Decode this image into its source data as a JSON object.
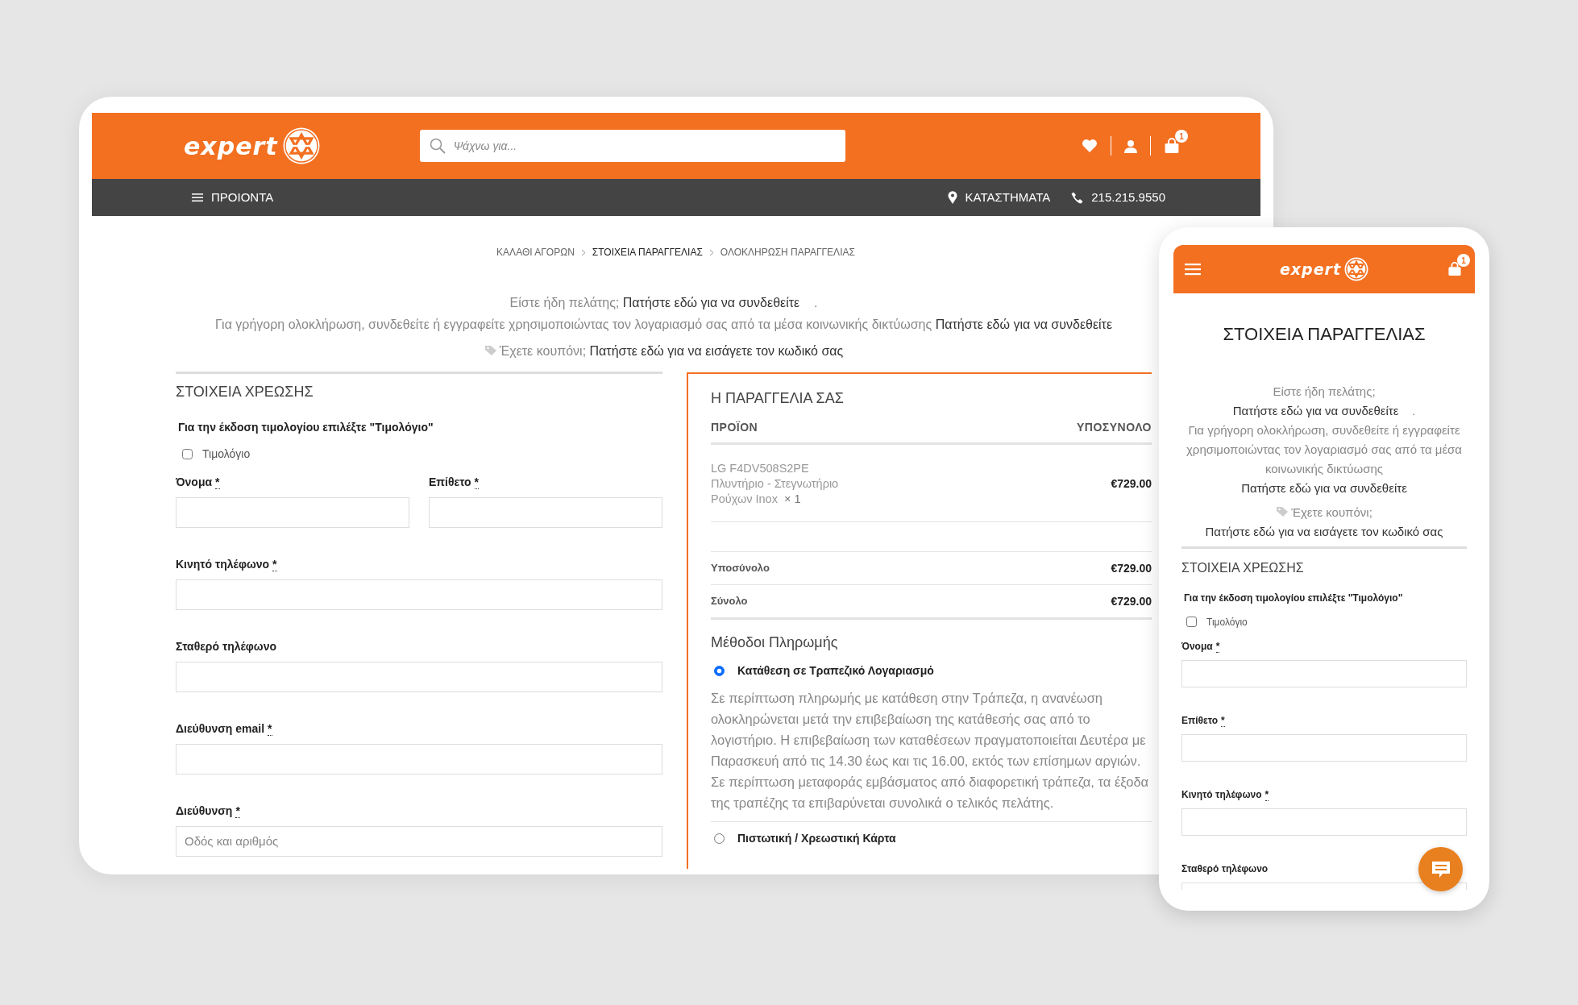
{
  "desktop": {
    "header": {
      "logo_text": "expert",
      "search_placeholder": "Ψάχνω για...",
      "cart_count": "1"
    },
    "nav": {
      "menu": "ΠΡΟΙΟΝΤΑ",
      "stores": "ΚΑΤΑΣΤΗΜΑΤΑ",
      "phone": "215.215.9550"
    },
    "breadcrumb": [
      {
        "label": "ΚΑΛΑΘΙ ΑΓΟΡΩΝ",
        "selected": false
      },
      {
        "label": "ΣΤΟΙΧΕΙΑ ΠΑΡΑΓΓΕΛΙΑΣ",
        "selected": true
      },
      {
        "label": "ΟΛΟΚΛΗΡΩΣΗ ΠΑΡΑΓΓΕΛΙΑΣ",
        "selected": false
      }
    ],
    "notices": [
      {
        "kind": "login",
        "text": "Είστε ήδη πελάτης;",
        "link": "Πατήστε εδώ για να συνδεθείτε",
        "suffix": "."
      },
      {
        "kind": "login",
        "text": "Για γρήγορη ολοκλήρωση, συνδεθείτε ή εγγραφείτε χρησιμοποιώντας τον λογαριασμό σας από τα μέσα κοινωνικής δικτύωσης",
        "link": "Πατήστε εδώ για να συνδεθείτε"
      },
      {
        "kind": "coupon",
        "text": "Έχετε κουπόνι;",
        "link": "Πατήστε εδώ για να εισάγετε τον κωδικό σας"
      }
    ],
    "billing": {
      "title": "ΣΤΟΙΧΕΙΑ ΧΡΕΩΣΗΣ",
      "invoice_hint": "Για την έκδοση τιμολογίου επιλέξτε \"Τιμολόγιο\"",
      "invoice_checkbox": {
        "label": "Τιμολόγιο",
        "checked": false
      },
      "fields": [
        {
          "kind": "half",
          "label": "Όνομα",
          "required_mark": "*"
        },
        {
          "kind": "half",
          "label": "Επίθετο",
          "required_mark": "*"
        },
        {
          "kind": "full",
          "label": "Κινητό τηλέφωνο",
          "required_mark": "*"
        },
        {
          "kind": "full",
          "label": "Σταθερό τηλέφωνο"
        },
        {
          "kind": "full",
          "label": "Διεύθυνση email",
          "required_mark": "*"
        },
        {
          "kind": "full",
          "label": "Διεύθυνση",
          "required_mark": "*",
          "placeholder": "Οδός και αριθμός"
        }
      ]
    },
    "order": {
      "title": "Η ΠΑΡΑΓΓΕΛΙΑ ΣΑΣ",
      "columns": [
        "ΠΡΟΪΟΝ",
        "ΥΠΟΣΥΝΟΛΟ"
      ],
      "items": [
        {
          "name": "LG F4DV508S2PE Πλυντήριο - Στεγνωτήριο Ρούχων Inox",
          "quantity": "× 1",
          "price": "€729.00"
        }
      ],
      "totals": [
        {
          "label": "Υποσύνολο",
          "value": "€729.00"
        },
        {
          "label": "Σύνολο",
          "value": "€729.00"
        }
      ],
      "payment_title": "Μέθοδοι Πληρωμής",
      "payment_methods": [
        {
          "label": "Κατάθεση σε Τραπεζικό Λογαριασμό",
          "selected": true,
          "description": "Σε περίπτωση πληρωμής με κατάθεση στην Τράπεζα, η ανανέωση ολοκληρώνεται μετά την επιβεβαίωση της κατάθεσής σας από το λογιστήριο. Η επιβεβαίωση των καταθέσεων πραγματοποιείται Δευτέρα με Παρασκευή από τις 14.30 έως και τις 16.00, εκτός των επίσημων αργιών. Σε περίπτωση μεταφοράς εμβάσματος από διαφορετική τράπεζα, τα έξοδα της τραπέζης τα επιβαρύνεται συνολικά ο τελικός πελάτης."
        },
        {
          "label": "Πιστωτική / Χρεωστική Κάρτα",
          "selected": false
        }
      ]
    }
  },
  "mobile": {
    "header": {
      "logo_text": "expert",
      "cart_count": "1"
    },
    "title": "ΣΤΟΙΧΕΙΑ ΠΑΡΑΓΓΕΛΙΑΣ",
    "notices": [
      {
        "kind": "login",
        "text": "Είστε ήδη πελάτης;",
        "link": "Πατήστε εδώ για να συνδεθείτε",
        "suffix": "."
      },
      {
        "kind": "login",
        "text": "Για γρήγορη ολοκλήρωση, συνδεθείτε ή εγγραφείτε χρησιμοποιώντας τον λογαριασμό σας από τα μέσα κοινωνικής δικτύωσης",
        "link": "Πατήστε εδώ για να συνδεθείτε"
      },
      {
        "kind": "coupon",
        "text": "Έχετε κουπόνι;",
        "link": "Πατήστε εδώ για να εισάγετε τον κωδικό σας"
      }
    ],
    "billing": {
      "title": "ΣΤΟΙΧΕΙΑ ΧΡΕΩΣΗΣ",
      "invoice_hint": "Για την έκδοση τιμολογίου επιλέξτε \"Τιμολόγιο\"",
      "invoice_checkbox": {
        "label": "Τιμολόγιο",
        "checked": false
      },
      "fields": [
        {
          "label": "Όνομα",
          "required_mark": "*"
        },
        {
          "label": "Επίθετο",
          "required_mark": "*"
        },
        {
          "label": "Κινητό τηλέφωνο",
          "required_mark": "*"
        },
        {
          "label": "Σταθερό τηλέφωνο"
        }
      ]
    }
  }
}
